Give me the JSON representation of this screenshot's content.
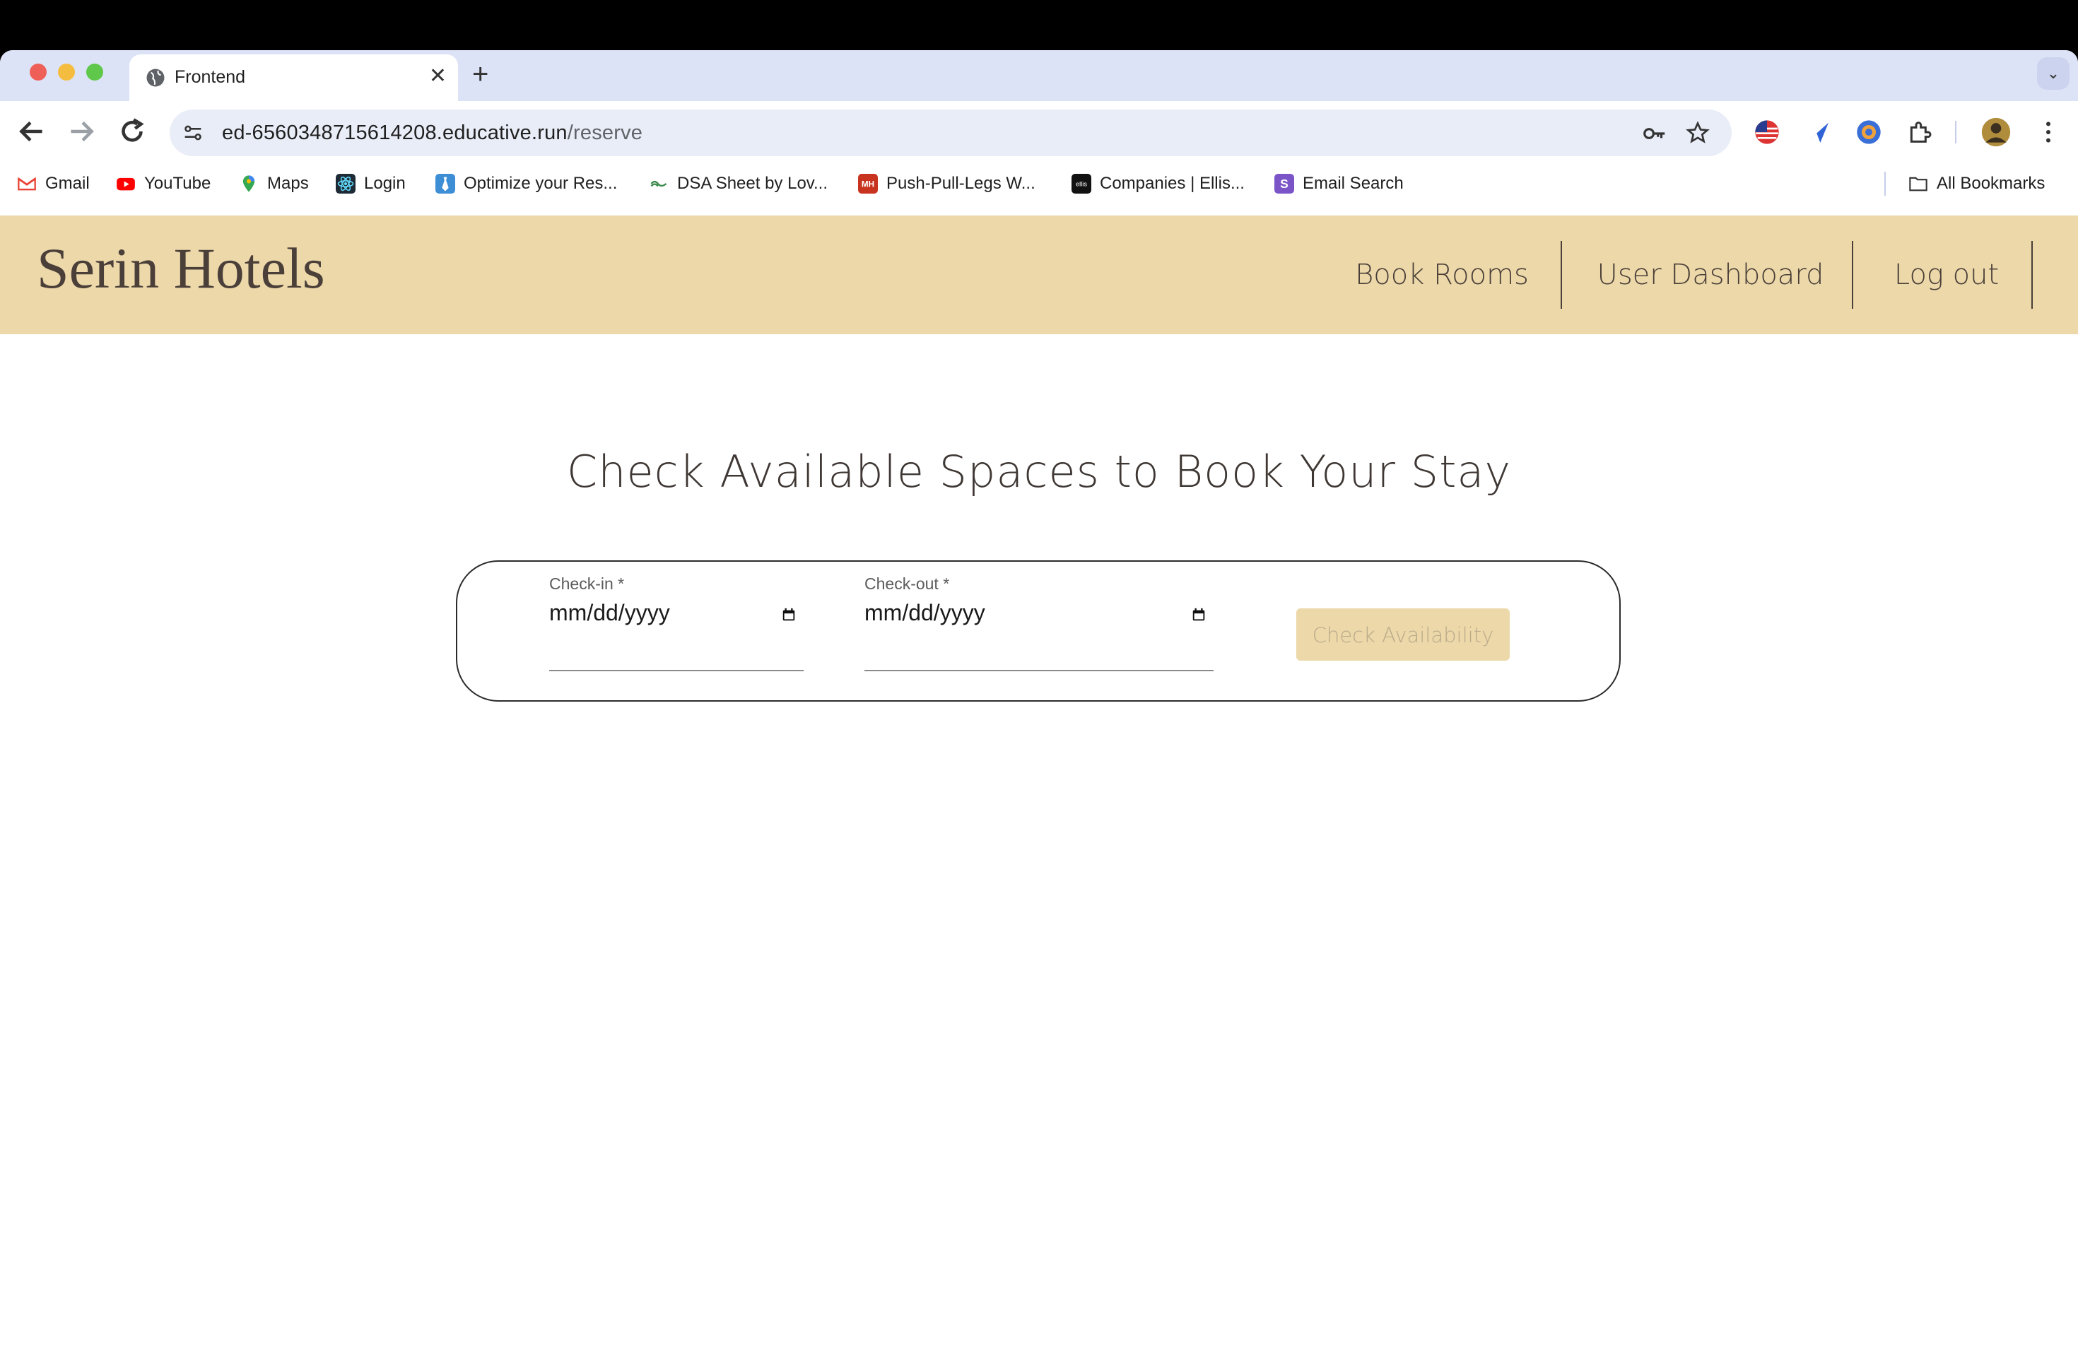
{
  "browser": {
    "tab_title": "Frontend",
    "url_host": "ed-6560348715614208.educative.run",
    "url_path": "/reserve",
    "bookmarks": [
      {
        "label": "Gmail",
        "icon": "gmail-icon"
      },
      {
        "label": "YouTube",
        "icon": "youtube-icon"
      },
      {
        "label": "Maps",
        "icon": "maps-icon"
      },
      {
        "label": "Login",
        "icon": "react-icon"
      },
      {
        "label": "Optimize your Res...",
        "icon": "tie-icon"
      },
      {
        "label": "DSA Sheet by Lov...",
        "icon": "link-icon"
      },
      {
        "label": "Push-Pull-Legs W...",
        "icon": "mh-icon"
      },
      {
        "label": "Companies | Ellis...",
        "icon": "ellis-icon"
      },
      {
        "label": "Email Search",
        "icon": "s-icon"
      }
    ],
    "all_bookmarks": "All Bookmarks"
  },
  "site": {
    "brand": "Serin Hotels",
    "nav": {
      "book_rooms": "Book Rooms",
      "user_dashboard": "User Dashboard",
      "log_out": "Log out"
    },
    "heading": "Check Available Spaces to Book Your Stay",
    "form": {
      "checkin_label": "Check-in *",
      "checkin_value": "mm/dd/yyyy",
      "checkout_label": "Check-out *",
      "checkout_value": "mm/dd/yyyy",
      "submit_label": "Check Availability"
    }
  },
  "colors": {
    "header_bg": "#ecd8a9",
    "brand_text": "#4a3f39"
  }
}
